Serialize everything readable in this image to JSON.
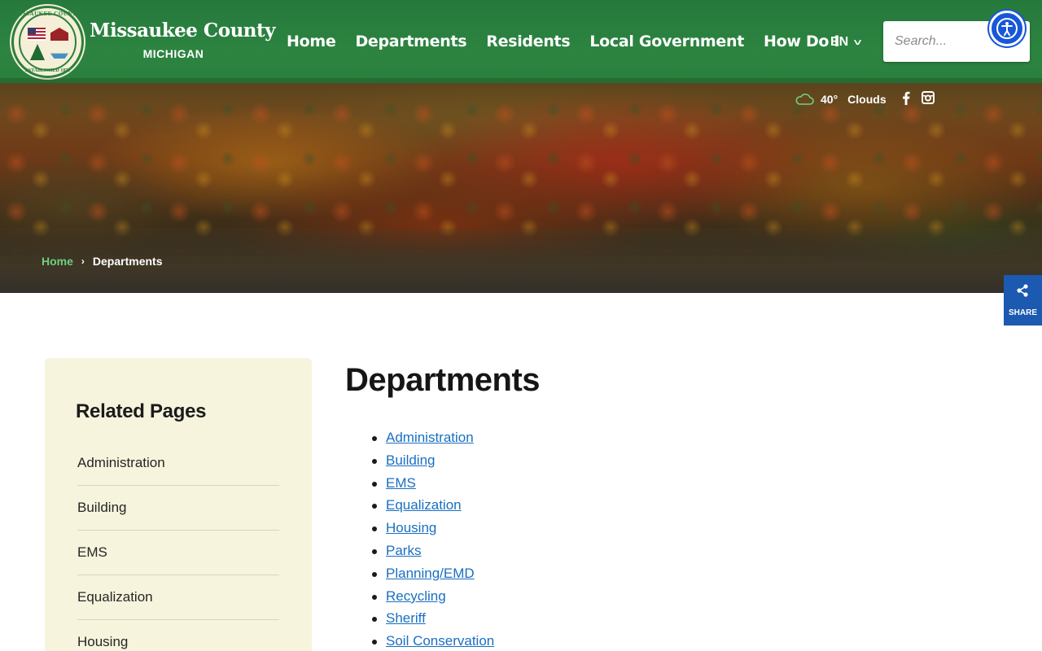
{
  "header": {
    "site_title": "Missaukee County",
    "site_subtitle": "MICHIGAN",
    "logo": {
      "ring_text_top": "MISSAUKEE COUNTY",
      "ring_text_bottom": "ESTABLISHED 1871"
    },
    "nav": [
      {
        "label": "Home"
      },
      {
        "label": "Departments"
      },
      {
        "label": "Residents"
      },
      {
        "label": "Local Government"
      },
      {
        "label": "How Do I"
      }
    ],
    "language": "EN",
    "search_placeholder": "Search..."
  },
  "weather": {
    "temperature": "40°",
    "condition": "Clouds",
    "icon": "cloud-icon"
  },
  "social": [
    "facebook-icon",
    "instagram-icon"
  ],
  "breadcrumb": {
    "home": "Home",
    "separator": "›",
    "current": "Departments"
  },
  "share": {
    "label": "SHARE",
    "icon": "share-icon"
  },
  "sidebar": {
    "title": "Related Pages",
    "items": [
      {
        "label": "Administration"
      },
      {
        "label": "Building"
      },
      {
        "label": "EMS"
      },
      {
        "label": "Equalization"
      },
      {
        "label": "Housing"
      }
    ]
  },
  "main": {
    "title": "Departments",
    "departments": [
      {
        "label": "Administration"
      },
      {
        "label": "Building"
      },
      {
        "label": "EMS"
      },
      {
        "label": "Equalization"
      },
      {
        "label": "Housing"
      },
      {
        "label": "Parks"
      },
      {
        "label": "Planning/EMD"
      },
      {
        "label": "Recycling"
      },
      {
        "label": "Sheriff"
      },
      {
        "label": "Soil Conservation"
      }
    ]
  },
  "colors": {
    "header_green": "#2b7f3e",
    "breadcrumb_link": "#6fd17e",
    "link_blue": "#1a6fc2",
    "sidebar_bg": "#f6f4dc",
    "share_blue": "#1c59b0",
    "accessibility_blue": "#1757d8"
  }
}
